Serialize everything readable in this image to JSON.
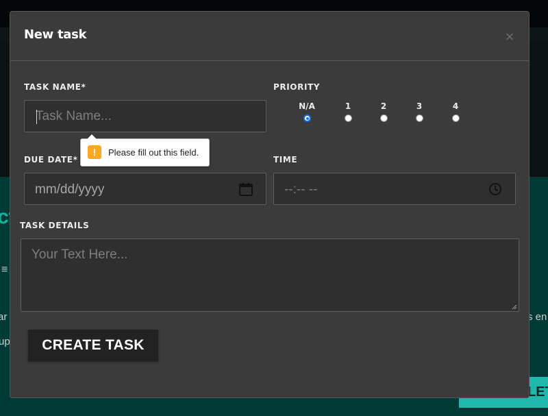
{
  "background": {
    "heading_fragment": "ct",
    "text_left_1": "ar",
    "text_left_2": "up",
    "text_right_1": "s en",
    "button_fragment": "LETE",
    "icon_fragment": "≡"
  },
  "modal": {
    "title": "New task",
    "close_glyph": "×",
    "task_name": {
      "label": "TASK NAME*",
      "placeholder": "Task Name...",
      "value": ""
    },
    "priority": {
      "label": "PRIORITY",
      "options": [
        "N/A",
        "1",
        "2",
        "3",
        "4"
      ],
      "selected": "N/A"
    },
    "due_date": {
      "label": "DUE DATE*",
      "placeholder": "mm/dd/yyyy",
      "icon": "calendar-icon"
    },
    "time": {
      "label": "TIME",
      "placeholder": "--:-- --",
      "icon": "clock-icon"
    },
    "task_details": {
      "label": "TASK DETAILS",
      "placeholder": "Your Text Here..."
    },
    "validation": {
      "message": "Please fill out this field.",
      "icon": "warning-icon",
      "icon_glyph": "!"
    },
    "submit_label": "CREATE TASK"
  },
  "colors": {
    "modal_bg": "#3b3b3b",
    "field_bg": "#2f2f2f",
    "accent_radio": "#1a73e8",
    "warning": "#f9a825",
    "background_teal": "#003a36"
  }
}
